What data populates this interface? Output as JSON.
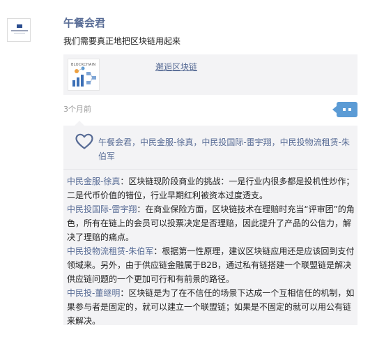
{
  "post": {
    "author": "午餐会君",
    "text": "我们需要真正地把区块链用起来",
    "link": {
      "thumb_label": "BLOCKCHAIN",
      "title": "邂逅区块链"
    },
    "time": "3个月前"
  },
  "likes": {
    "names": "午餐会君，中民金服-徐真，中民投国际-雷宇翔，中民投物流租赁-朱伯军"
  },
  "comments": [
    {
      "author": "中民金服-徐真",
      "sep": "：",
      "text": "区块链现阶段商业的挑战：一是行业内很多都是投机性炒作；二是代币价值的错位，行业早期红利被资本过度透支。"
    },
    {
      "author": "中民投国际-雷宇翔",
      "sep": "：",
      "text": "在商业保险方面，区块链技术在理赔时充当“评审团”的角色，所有在链上的会员可以投票决定是否理赔，因此提升了产品的公信力，解决了理赔的痛点。"
    },
    {
      "author": "中民投物流租赁-朱伯军",
      "sep": "：",
      "text": "根据第一性原理，建议区块链应用还是应该回到支付领域来。另外，由于供应链金融属于B2B，通过私有链搭建一个联盟链是解决供应链问题的一个更加可行和有前景的路径。"
    },
    {
      "author": "中民投-董继明",
      "sep": "：",
      "text": "区块链是为了在不信任的场景下达成一个互相信任的机制，如果参与者是固定的，就可以建立一个联盟链；如果是不固定的就可以用公有链来解决。"
    }
  ],
  "colors": {
    "link": "#576b95",
    "accent": "#5b9bd5",
    "panel": "#f3f3f5"
  },
  "icons": {
    "avatar": "company-logo",
    "like": "heart-icon",
    "comment": "comment-dots-icon"
  }
}
